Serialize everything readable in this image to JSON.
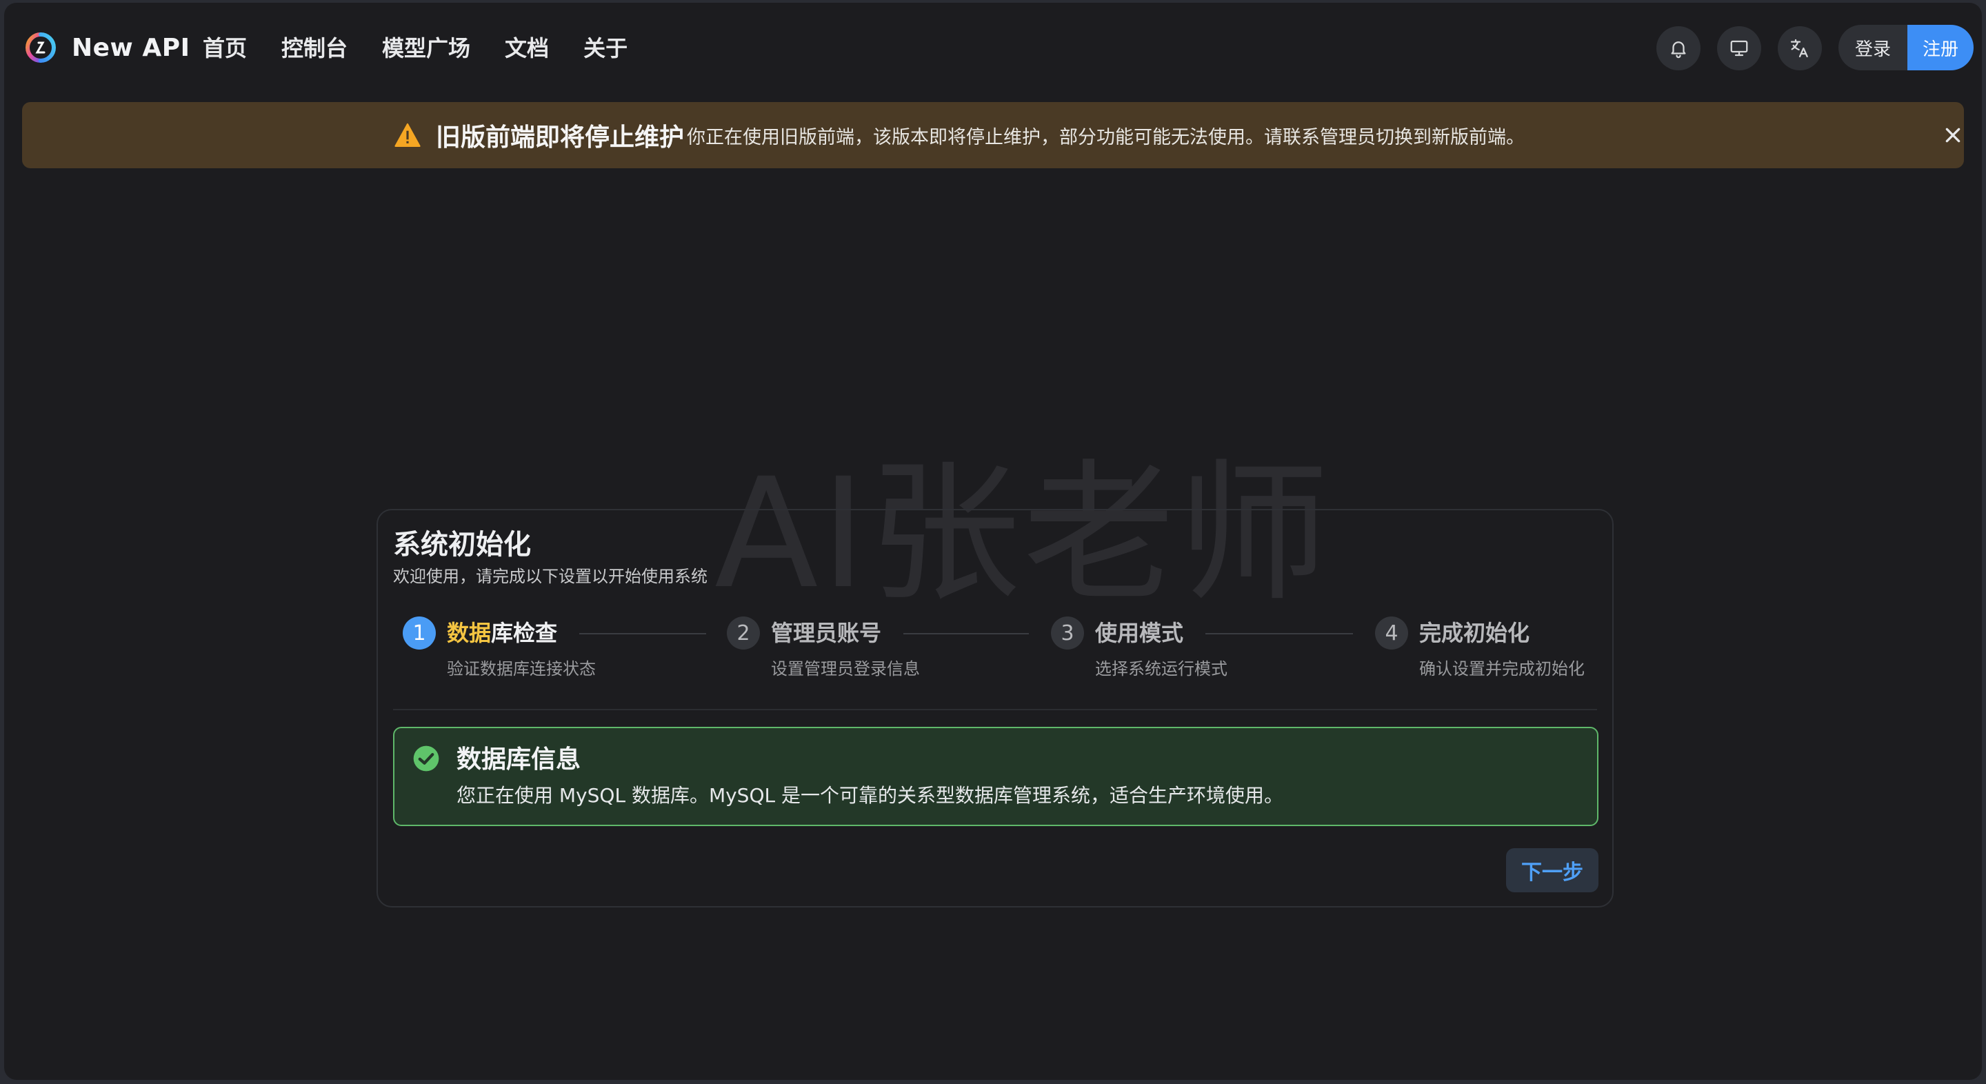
{
  "header": {
    "brand": "New API",
    "nav": [
      "首页",
      "控制台",
      "模型广场",
      "文档",
      "关于"
    ],
    "login_label": "登录",
    "register_label": "注册",
    "icons": [
      "bell-icon",
      "monitor-icon",
      "translate-icon"
    ]
  },
  "banner": {
    "title": "旧版前端即将停止维护",
    "text": "你正在使用旧版前端，该版本即将停止维护，部分功能可能无法使用。请联系管理员切换到新版前端。",
    "color": "#4a3a25",
    "icon": "warning-icon"
  },
  "watermark": "AI张老师",
  "setup": {
    "title": "系统初始化",
    "subtitle": "欢迎使用，请完成以下设置以开始使用系统",
    "current_step": 1,
    "steps": [
      {
        "num": "1",
        "title_highlight": "数据",
        "title_rest": "库检查",
        "desc": "验证数据库连接状态"
      },
      {
        "num": "2",
        "title": "管理员账号",
        "desc": "设置管理员登录信息"
      },
      {
        "num": "3",
        "title": "使用模式",
        "desc": "选择系统运行模式"
      },
      {
        "num": "4",
        "title": "完成初始化",
        "desc": "确认设置并完成初始化"
      }
    ],
    "alert": {
      "title": "数据库信息",
      "text": "您正在使用 MySQL 数据库。MySQL 是一个可靠的关系型数据库管理系统，适合生产环境使用。",
      "color": "#5fb86a"
    },
    "next_label": "下一步",
    "accent": "#4a9cf5"
  }
}
